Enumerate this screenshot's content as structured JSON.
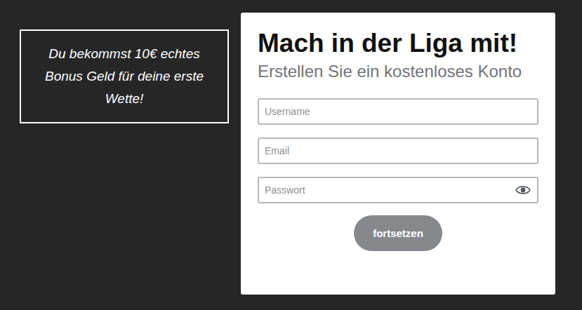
{
  "promo": {
    "text": "Du bekommst 10€ echtes Bonus Geld für deine erste Wette!"
  },
  "signup": {
    "title": "Mach in der Liga mit!",
    "subtitle": "Erstellen Sie ein kostenloses Konto",
    "fields": [
      {
        "placeholder": "Username",
        "kind": "text"
      },
      {
        "placeholder": "Email",
        "kind": "email"
      },
      {
        "placeholder": "Passwort",
        "kind": "password"
      }
    ],
    "button": {
      "label": "fortsetzen",
      "disabled": true
    }
  }
}
